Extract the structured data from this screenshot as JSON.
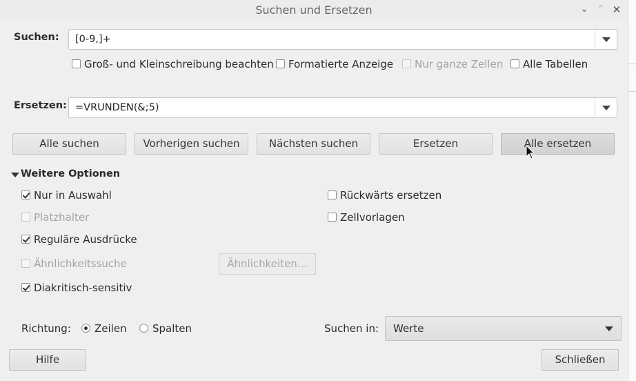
{
  "window": {
    "title": "Suchen und Ersetzen",
    "controls": [
      "chevron-down-icon",
      "chevron-up-icon",
      "close-icon"
    ]
  },
  "search": {
    "label": "Suchen:",
    "value": "[0-9,]+"
  },
  "search_options": [
    {
      "label": "Groß- und Kleinschreibung beachten",
      "checked": false,
      "disabled": false
    },
    {
      "label": "Formatierte Anzeige",
      "checked": false,
      "disabled": false
    },
    {
      "label": "Nur ganze Zellen",
      "checked": false,
      "disabled": true
    },
    {
      "label": "Alle Tabellen",
      "checked": false,
      "disabled": false
    }
  ],
  "replace": {
    "label": "Ersetzen:",
    "value": "=VRUNDEN(&;5)"
  },
  "actions": {
    "find_all": "Alle suchen",
    "find_prev": "Vorherigen suchen",
    "find_next": "Nächsten suchen",
    "replace": "Ersetzen",
    "replace_all": "Alle ersetzen"
  },
  "more_options": {
    "label": "Weitere Optionen",
    "left": [
      {
        "label": "Nur in Auswahl",
        "checked": true,
        "disabled": false
      },
      {
        "label": "Platzhalter",
        "checked": false,
        "disabled": true
      },
      {
        "label": "Reguläre Ausdrücke",
        "checked": true,
        "disabled": false
      },
      {
        "label": "Ähnlichkeitssuche",
        "checked": false,
        "disabled": true
      },
      {
        "label": "Diakritisch-sensitiv",
        "checked": true,
        "disabled": false
      }
    ],
    "right": [
      {
        "label": "Rückwärts ersetzen",
        "checked": false,
        "disabled": false
      },
      {
        "label": "Zellvorlagen",
        "checked": false,
        "disabled": false
      }
    ],
    "similarity_button": "Ähnlichkeiten…"
  },
  "direction": {
    "label": "Richtung:",
    "options": [
      {
        "label": "Zeilen",
        "selected": true
      },
      {
        "label": "Spalten",
        "selected": false
      }
    ]
  },
  "search_in": {
    "label": "Suchen in:",
    "value": "Werte"
  },
  "footer": {
    "help": "Hilfe",
    "close": "Schließen"
  }
}
